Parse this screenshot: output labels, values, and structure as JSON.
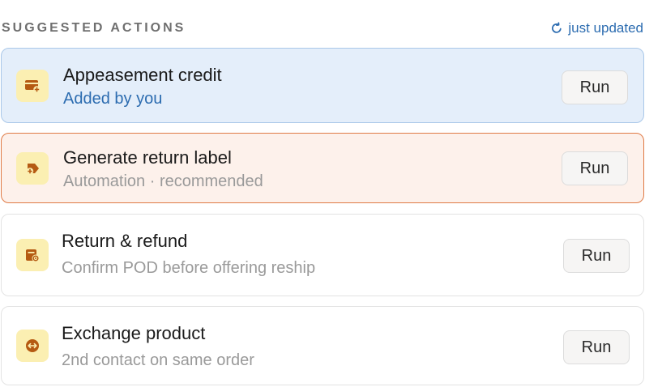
{
  "header": {
    "title": "SUGGESTED ACTIONS",
    "status": "just updated",
    "status_icon": "refresh-icon"
  },
  "colors": {
    "accent_blue": "#2c6cb0",
    "selected_bg": "#e4eefa",
    "recommended_border": "#e07a45",
    "icon_bg": "#fbefb2",
    "icon_fg": "#b55a12"
  },
  "actions": [
    {
      "title": "Appeasement credit",
      "subtitle": "Added by you",
      "button": "Run",
      "icon": "credit-card-plus-icon"
    },
    {
      "title": "Generate return label",
      "subtitle": "Automation · recommended",
      "button": "Run",
      "icon": "tag-plus-icon"
    },
    {
      "title": "Return & refund",
      "subtitle": "Confirm POD before offering reship",
      "button": "Run",
      "icon": "return-box-icon"
    },
    {
      "title": "Exchange product",
      "subtitle": "2nd contact on same order",
      "button": "Run",
      "icon": "exchange-arrows-icon"
    }
  ]
}
